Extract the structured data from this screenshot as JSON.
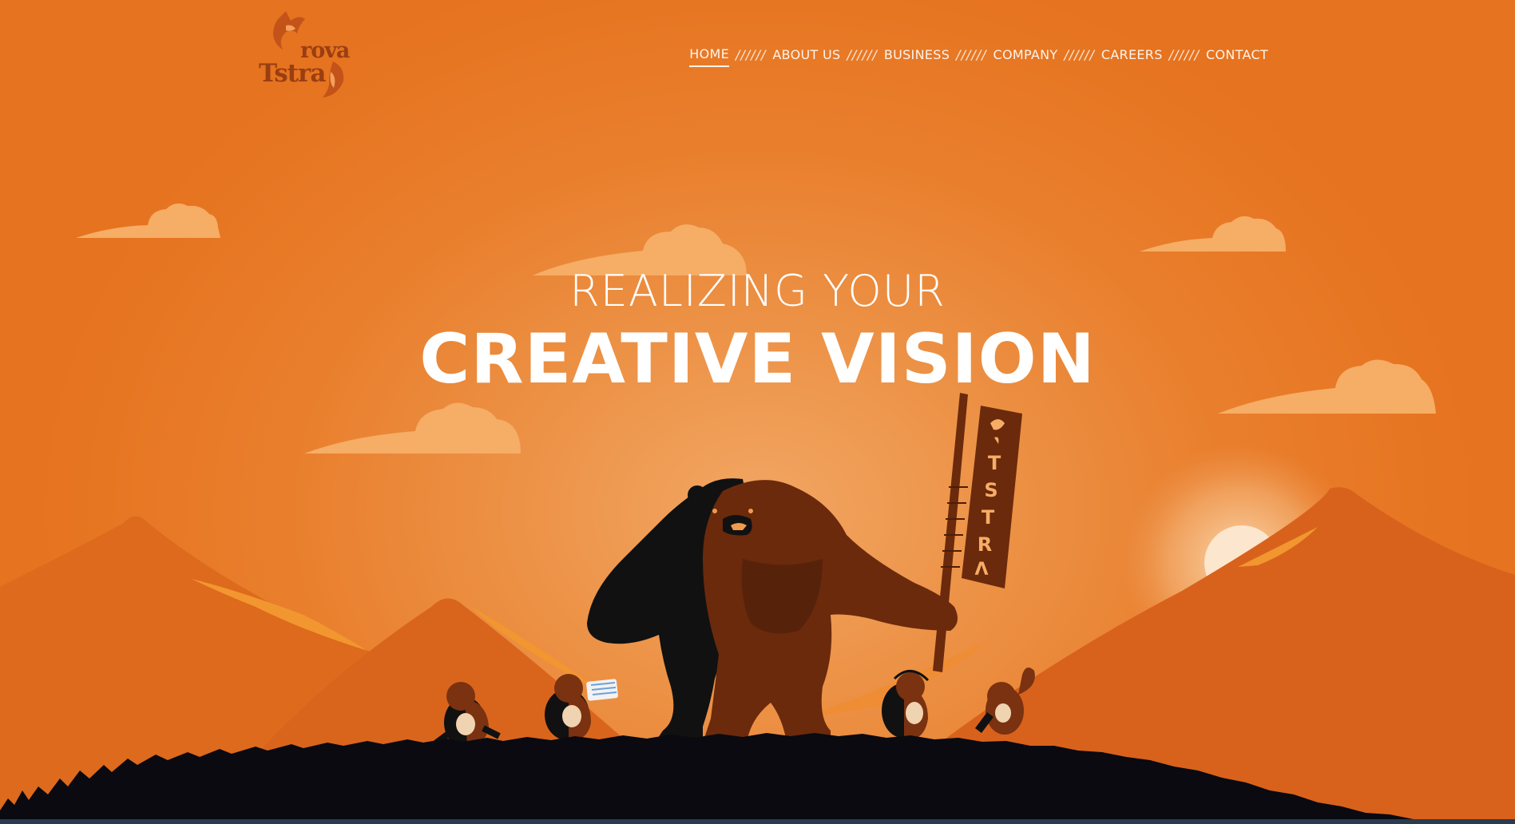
{
  "brand": {
    "logo_line1": "rova",
    "logo_line2": "Tstra",
    "icon": "fox-icon"
  },
  "nav": {
    "separator": "//////",
    "items": [
      {
        "label": "HOME",
        "active": true
      },
      {
        "label": "ABOUT US",
        "active": false
      },
      {
        "label": "BUSINESS",
        "active": false
      },
      {
        "label": "COMPANY",
        "active": false
      },
      {
        "label": "CAREERS",
        "active": false
      },
      {
        "label": "CONTACT",
        "active": false
      }
    ]
  },
  "hero": {
    "line1": "REALIZING YOUR",
    "line2": "CREATIVE VISION",
    "banner_letters": [
      "T",
      "S",
      "T",
      "R",
      "Λ"
    ]
  },
  "colors": {
    "sky": "#e8782a",
    "glow": "#f2a663",
    "cloud": "#f6ad65",
    "mountain": "#df6a1e",
    "grass": "#0a0a10",
    "bear_brown": "#6b2a0c",
    "bear_black": "#111111",
    "accent": "#9a3e12"
  }
}
